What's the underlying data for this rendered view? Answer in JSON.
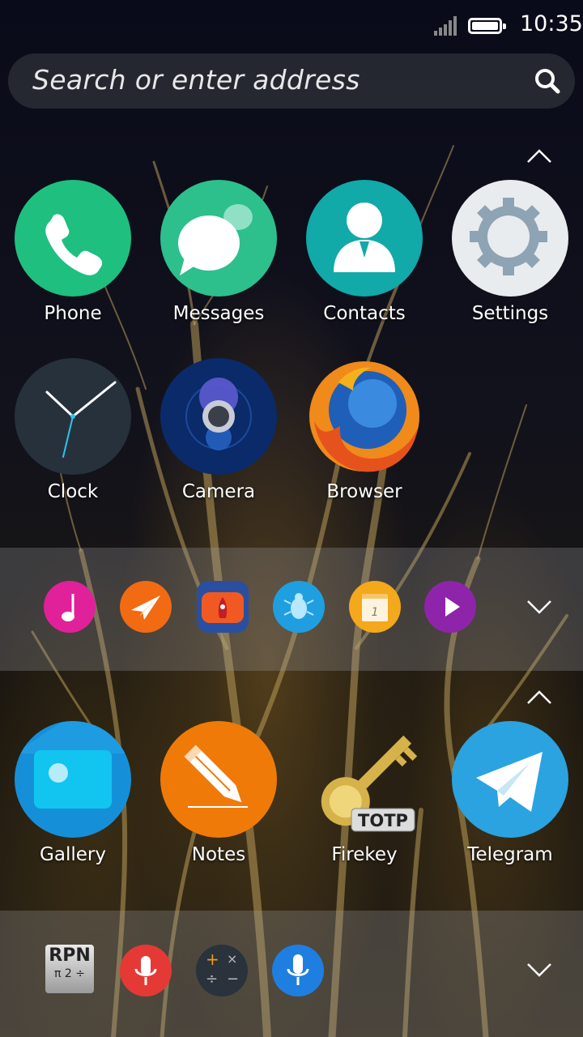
{
  "status_bar": {
    "time": "10:35"
  },
  "search": {
    "placeholder": "Search or enter address"
  },
  "apps_top": [
    {
      "label": "Phone"
    },
    {
      "label": "Messages"
    },
    {
      "label": "Contacts"
    },
    {
      "label": "Settings"
    },
    {
      "label": "Clock"
    },
    {
      "label": "Camera"
    },
    {
      "label": "Browser"
    }
  ],
  "collapsed_group_1_icons": [
    "music-icon",
    "paper-plane-icon",
    "rocket-icon",
    "bug-icon",
    "calendar-icon",
    "play-icon"
  ],
  "calendar_day": "1",
  "apps_bottom": [
    {
      "label": "Gallery"
    },
    {
      "label": "Notes"
    },
    {
      "label": "Firekey"
    },
    {
      "label": "Telegram"
    }
  ],
  "firekey_badge": "TOTP",
  "collapsed_group_2_icons": [
    "rpn-calculator-icon",
    "microphone-icon",
    "calculator-icon",
    "voice-input-icon"
  ],
  "rpn": {
    "top": "RPN",
    "bottom": "π 2 ÷"
  },
  "calc_symbols": {
    "plus": "+",
    "times": "×",
    "divide": "÷",
    "minus": "−"
  },
  "colors": {
    "phone": "#1fbf7f",
    "messages": "#2dbf8c",
    "contacts": "#12a9a9",
    "settings": "#e8ecef",
    "clock": "#27313c",
    "camera": "#0a2a6a",
    "gallery": "#1590d8",
    "notes": "#f07a08",
    "telegram": "#2aa3e0"
  }
}
